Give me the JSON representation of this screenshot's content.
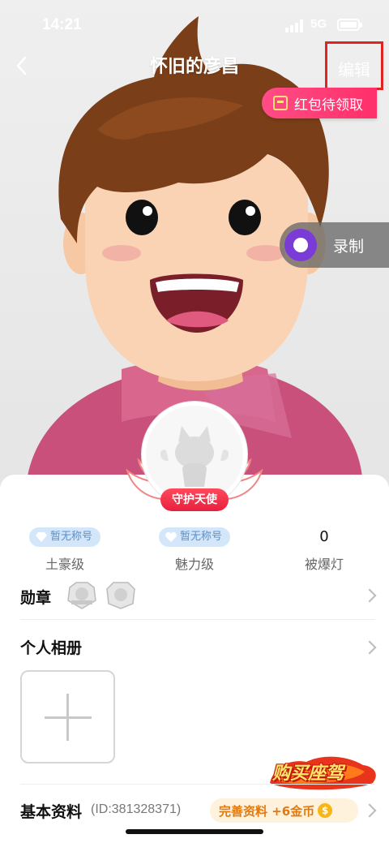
{
  "status_bar": {
    "time": "14:21",
    "network": "5G"
  },
  "header": {
    "title": "怀旧的彦昌",
    "edit_label": "编辑"
  },
  "redpacket": {
    "label": "红包待领取"
  },
  "record": {
    "label": "录制"
  },
  "guardian": {
    "label": "守护天使"
  },
  "stats": [
    {
      "badge": "暂无称号",
      "label": "土豪级"
    },
    {
      "badge": "暂无称号",
      "label": "魅力级"
    },
    {
      "value": "0",
      "label": "被爆灯"
    }
  ],
  "medals": {
    "title": "勋章"
  },
  "album": {
    "title": "个人相册"
  },
  "promo": {
    "label": "购买座驾"
  },
  "basic_info": {
    "title": "基本资料",
    "id_text": "(ID:381328371)",
    "complete_label": "完善资料 +6金币",
    "coin_glyph": "$"
  },
  "colors": {
    "accent": "#ff2f6a",
    "edit_highlight": "#e02424",
    "record": "#7b3bd6"
  }
}
